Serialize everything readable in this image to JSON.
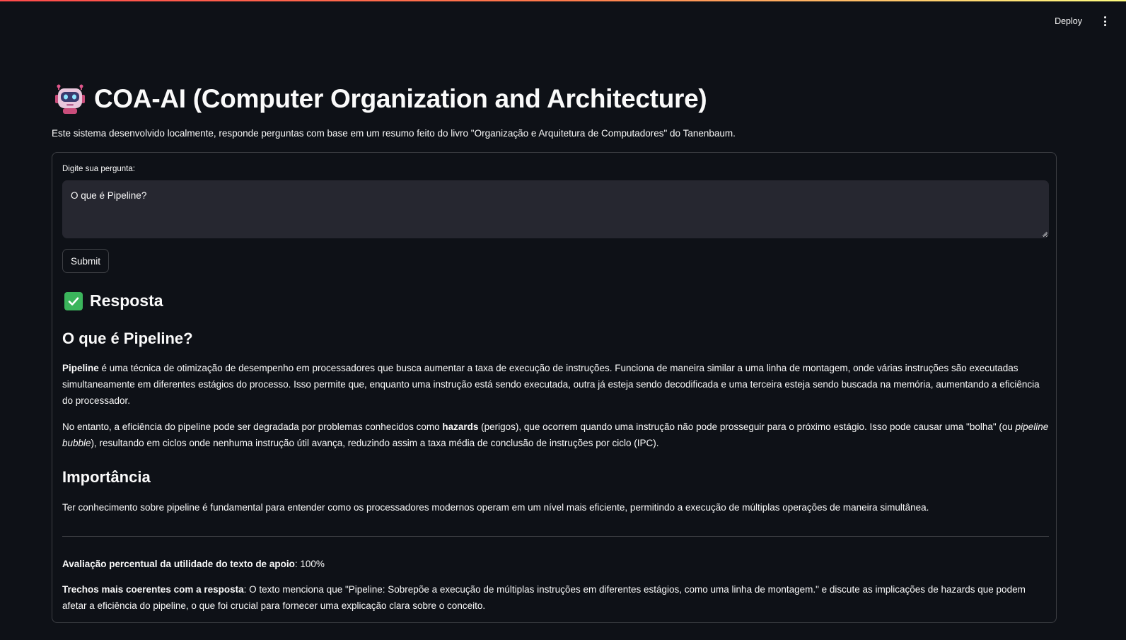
{
  "header": {
    "deploy_label": "Deploy",
    "menu_icon": "vertical-ellipsis-icon"
  },
  "app": {
    "title_icon": "robot-icon",
    "title": "COA-AI (Computer Organization and Architecture)",
    "intro": "Este sistema desenvolvido localmente, responde perguntas com base em um resumo feito do livro \"Organização e Arquitetura de Computadores\" do Tanenbaum."
  },
  "form": {
    "question_label": "Digite sua pergunta:",
    "question_value": "O que é Pipeline?",
    "submit_label": "Submit"
  },
  "response": {
    "header_icon": "check-mark-icon",
    "header": "Resposta",
    "heading_1": "O que é Pipeline?",
    "p1": {
      "term": "Pipeline",
      "text": " é uma técnica de otimização de desempenho em processadores que busca aumentar a taxa de execução de instruções. Funciona de maneira similar a uma linha de montagem, onde várias instruções são executadas simultaneamente em diferentes estágios do processo. Isso permite que, enquanto uma instrução está sendo executada, outra já esteja sendo decodificada e uma terceira esteja sendo buscada na memória, aumentando a eficiência do processador."
    },
    "p2": {
      "text_before": "No entanto, a eficiência do pipeline pode ser degradada por problemas conhecidos como ",
      "term": "hazards",
      "text_middle": " (perigos), que ocorrem quando uma instrução não pode prosseguir para o próximo estágio. Isso pode causar uma \"bolha\" (ou ",
      "italic": "pipeline bubble",
      "text_after": "), resultando em ciclos onde nenhuma instrução útil avança, reduzindo assim a taxa média de conclusão de instruções por ciclo (IPC)."
    },
    "heading_2": "Importância",
    "p3": "Ter conhecimento sobre pipeline é fundamental para entender como os processadores modernos operam em um nível mais eficiente, permitindo a execução de múltiplas operações de maneira simultânea."
  },
  "evaluation": {
    "utility_label": "Avaliação percentual da utilidade do texto de apoio",
    "utility_value": ": 100%",
    "excerpts_label": "Trechos mais coerentes com a resposta",
    "excerpts_value": ": O texto menciona que \"Pipeline: Sobrepõe a execução de múltiplas instruções em diferentes estágios, como uma linha de montagem.\" e discute as implicações de hazards que podem afetar a eficiência do pipeline, o que foi crucial para fornecer uma explicação clara sobre o conceito."
  },
  "colors": {
    "background": "#0e1117",
    "text": "#fafafa",
    "input_bg": "#262730",
    "accent_check": "#3bb55c"
  }
}
